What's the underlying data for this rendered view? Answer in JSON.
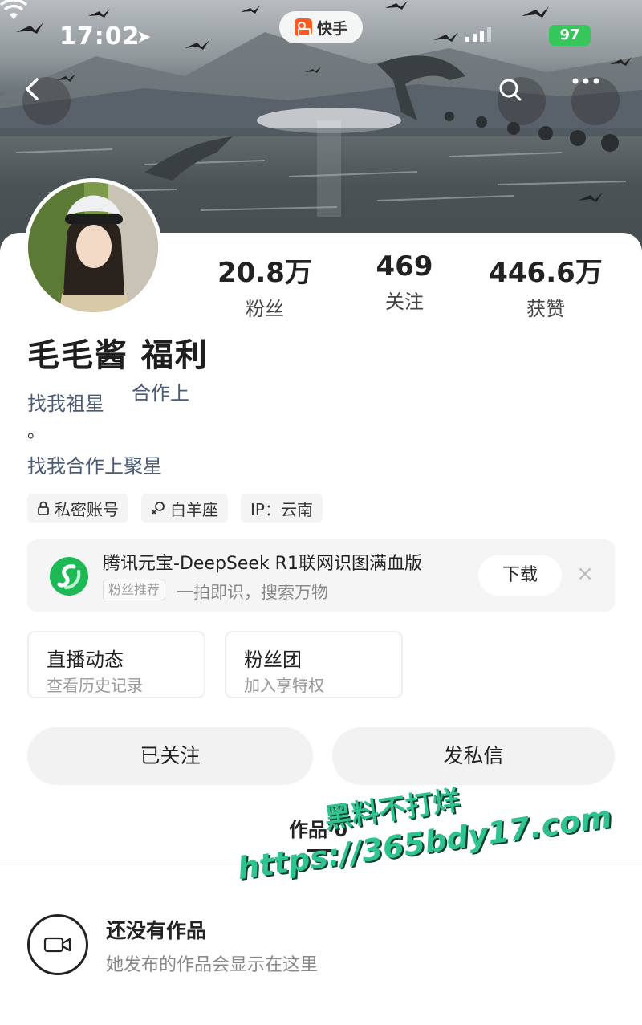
{
  "status_bar": {
    "time": "17:02",
    "app_badge": "快手",
    "battery": "97"
  },
  "profile": {
    "nickname": "毛毛酱 福利",
    "bio_line_a": "找我袓星",
    "bio_line_b": "合作上",
    "bio_dot": "。",
    "bio_line_c": "找我合作上聚星",
    "stats": [
      {
        "value": "20.8万",
        "label": "粉丝"
      },
      {
        "value": "469",
        "label": "关注"
      },
      {
        "value": "446.6万",
        "label": "获赞"
      }
    ],
    "tags": [
      {
        "icon": "lock-icon",
        "label": "私密账号"
      },
      {
        "icon": "aries-icon",
        "label": "白羊座"
      },
      {
        "icon": "",
        "label": "IP：云南"
      }
    ]
  },
  "ad": {
    "title": "腾讯元宝-DeepSeek R1联网识图满血版",
    "badge": "粉丝推荐",
    "subtitle": "一拍即识，搜索万物",
    "button": "下载",
    "close": "×"
  },
  "cards": [
    {
      "title": "直播动态",
      "subtitle": "查看历史记录"
    },
    {
      "title": "粉丝团",
      "subtitle": "加入享特权"
    }
  ],
  "actions": {
    "followed": "已关注",
    "message": "发私信"
  },
  "works": {
    "tab_label": "作品 0",
    "empty_title": "还没有作品",
    "empty_subtitle": "她发布的作品会显示在这里"
  },
  "watermark": {
    "line1": "黑料不打烊",
    "line2": "https://365bdy17.com"
  },
  "colors": {
    "link": "#4b5a78",
    "battery": "#35c759",
    "watermark": "#2fc48f"
  }
}
